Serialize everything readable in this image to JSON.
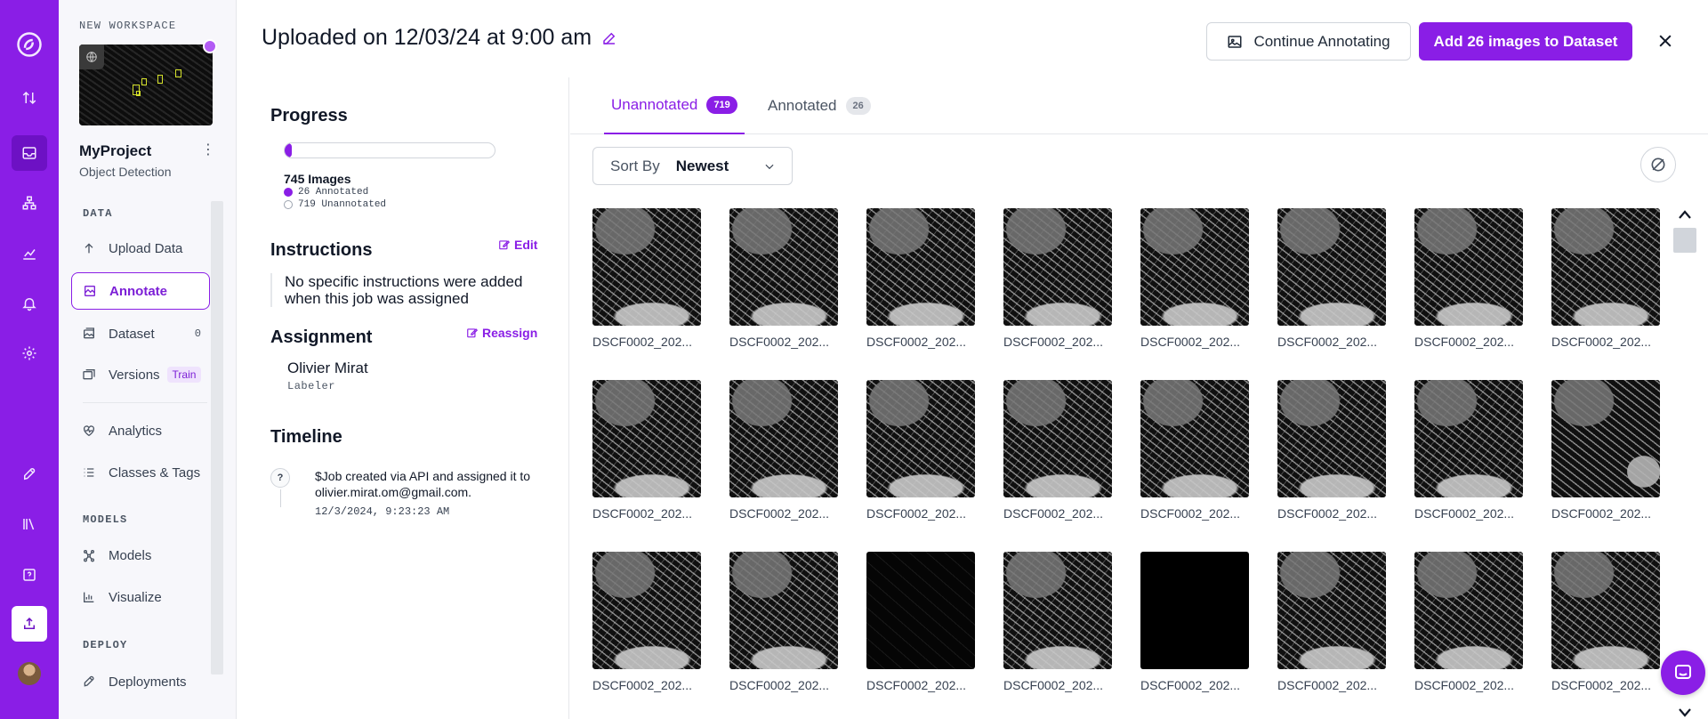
{
  "workspace": {
    "label": "NEW WORKSPACE"
  },
  "project": {
    "name": "MyProject",
    "type": "Object Detection"
  },
  "sidebar": {
    "sections": {
      "data": "DATA",
      "models": "MODELS",
      "deploy": "DEPLOY"
    },
    "items": [
      {
        "label": "Upload Data"
      },
      {
        "label": "Annotate"
      },
      {
        "label": "Dataset",
        "count": "0"
      },
      {
        "label": "Versions",
        "badge": "Train"
      },
      {
        "label": "Analytics"
      },
      {
        "label": "Classes & Tags"
      },
      {
        "label": "Models"
      },
      {
        "label": "Visualize"
      },
      {
        "label": "Deployments"
      }
    ]
  },
  "header": {
    "title": "Uploaded on 12/03/24 at 9:00 am",
    "continue_label": "Continue Annotating",
    "add_label": "Add 26 images to Dataset"
  },
  "info": {
    "progress_title": "Progress",
    "progress_fraction": 0.035,
    "images_total": "745 Images",
    "annotated": "26 Annotated",
    "unannotated": "719 Unannotated",
    "instructions_title": "Instructions",
    "edit_label": "Edit",
    "instructions_text": "No specific instructions were added when this job was assigned",
    "assignment_title": "Assignment",
    "reassign_label": "Reassign",
    "assignee": "Olivier Mirat",
    "role": "Labeler",
    "timeline_title": "Timeline",
    "timeline_icon": "?",
    "timeline_text": "$Job created via API and assigned it to olivier.mirat.om@gmail.com.",
    "timeline_time": "12/3/2024, 9:23:23 AM"
  },
  "main": {
    "tabs": [
      {
        "label": "Unannotated",
        "count": "719"
      },
      {
        "label": "Annotated",
        "count": "26"
      }
    ],
    "sort": {
      "label": "Sort By",
      "value": "Newest"
    },
    "images": [
      {
        "caption": "DSCF0002_202...",
        "style": "fish"
      },
      {
        "caption": "DSCF0002_202...",
        "style": "fish"
      },
      {
        "caption": "DSCF0002_202...",
        "style": "fish"
      },
      {
        "caption": "DSCF0002_202...",
        "style": "fish"
      },
      {
        "caption": "DSCF0002_202...",
        "style": "fish"
      },
      {
        "caption": "DSCF0002_202...",
        "style": "fish"
      },
      {
        "caption": "DSCF0002_202...",
        "style": "fish"
      },
      {
        "caption": "DSCF0002_202...",
        "style": "fish"
      },
      {
        "caption": "DSCF0002_202...",
        "style": "fish"
      },
      {
        "caption": "DSCF0002_202...",
        "style": "fish"
      },
      {
        "caption": "DSCF0002_202...",
        "style": "fish"
      },
      {
        "caption": "DSCF0002_202...",
        "style": "fish"
      },
      {
        "caption": "DSCF0002_202...",
        "style": "fish"
      },
      {
        "caption": "DSCF0002_202...",
        "style": "fish"
      },
      {
        "caption": "DSCF0002_202...",
        "style": "fish"
      },
      {
        "caption": "DSCF0002_202...",
        "style": "fishflat"
      },
      {
        "caption": "DSCF0002_202...",
        "style": "fish"
      },
      {
        "caption": "DSCF0002_202...",
        "style": "fish"
      },
      {
        "caption": "DSCF0002_202...",
        "style": "dark"
      },
      {
        "caption": "DSCF0002_202...",
        "style": "fish"
      },
      {
        "caption": "DSCF0002_202...",
        "style": "blank"
      },
      {
        "caption": "DSCF0002_202...",
        "style": "fish"
      },
      {
        "caption": "DSCF0002_202...",
        "style": "fish"
      },
      {
        "caption": "DSCF0002_202...",
        "style": "fish"
      }
    ]
  },
  "colors": {
    "brand": "#8a1ee6",
    "brand_dark": "#6d11c4",
    "arrow": "#f00d0d"
  },
  "icons": [
    "roboflow-logo-icon",
    "swap-icon",
    "inbox-icon",
    "hierarchy-icon",
    "chart-icon",
    "bell-icon",
    "gear-icon",
    "rocket-icon",
    "library-icon",
    "help-icon",
    "upload-icon",
    "pencil-icon",
    "image-icon",
    "close-icon",
    "chevron-down-icon",
    "eye-off-icon",
    "chat-icon"
  ]
}
